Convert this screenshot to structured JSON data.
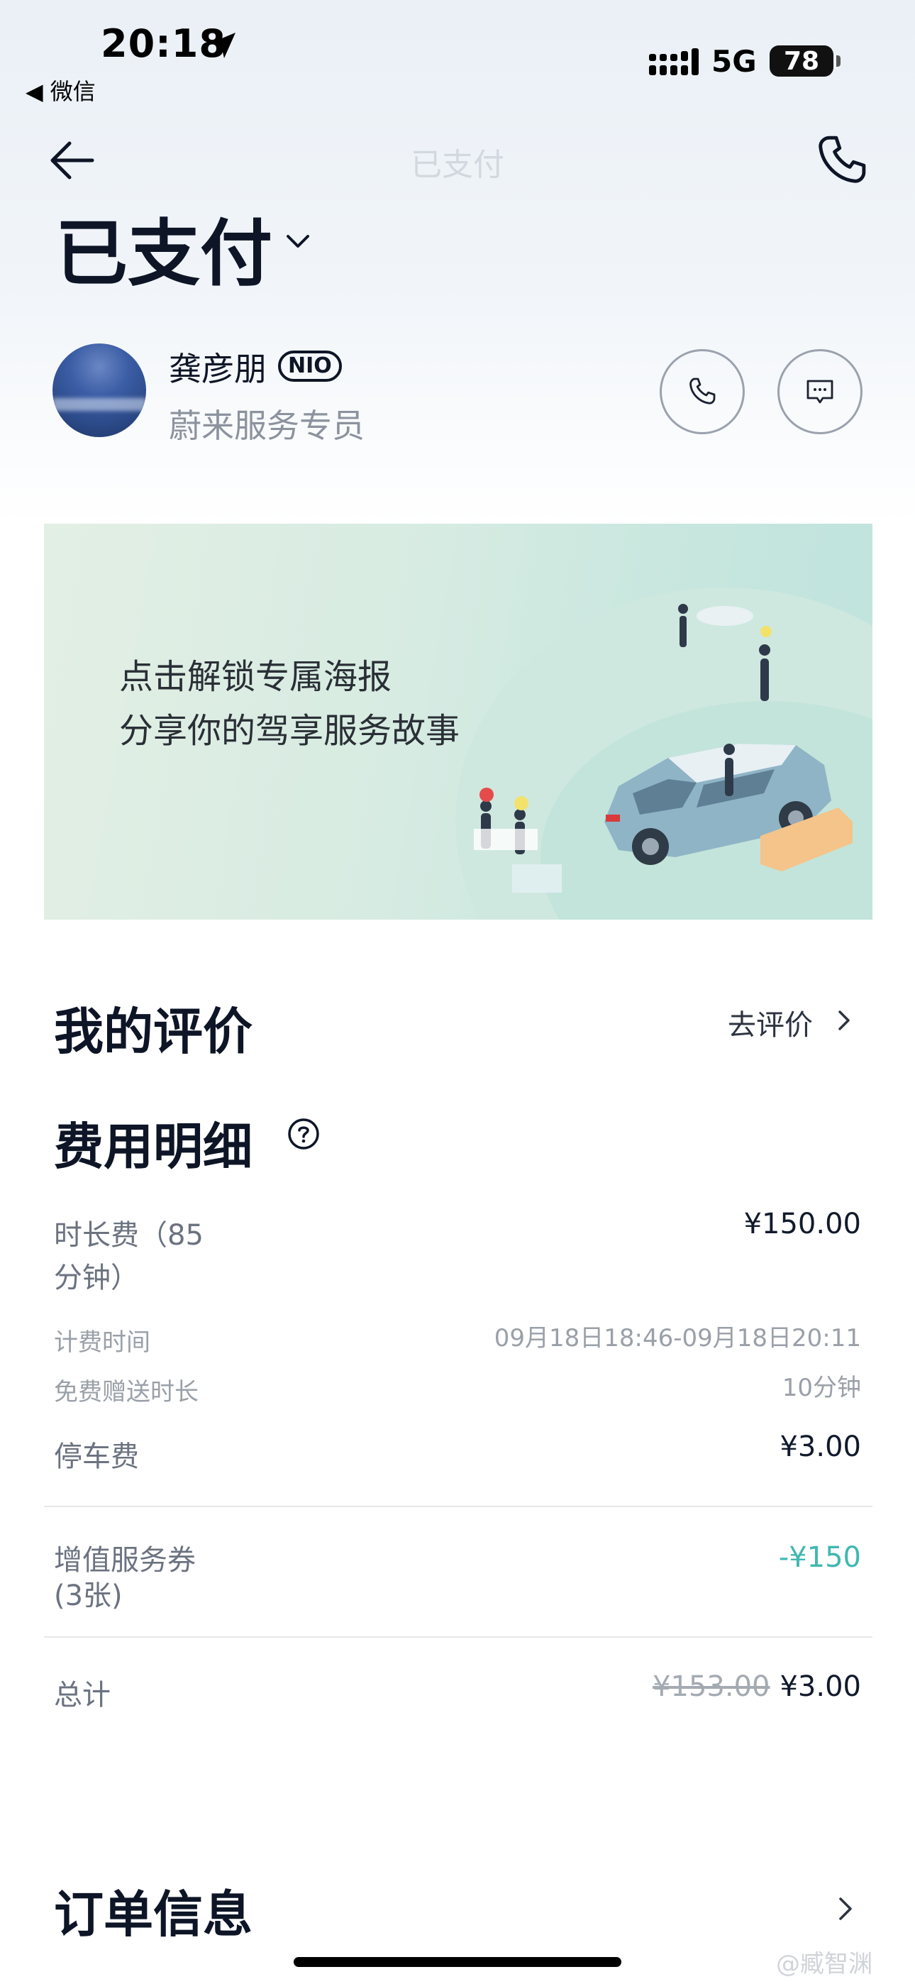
{
  "status_bar": {
    "time": "20:18",
    "back_app": "◀ 微信",
    "network": "5G",
    "battery": "78"
  },
  "nav": {
    "title": "已支付"
  },
  "order_status": {
    "title": "已支付"
  },
  "agent": {
    "name": "龚彦朋",
    "badge": "NIO",
    "role": "蔚来服务专员"
  },
  "banner": {
    "line1": "点击解锁专属海报",
    "line2": "分享你的驾享服务故事"
  },
  "review": {
    "title": "我的评价",
    "action": "去评价"
  },
  "fees": {
    "title": "费用明细",
    "duration_label_1": "时长费（85",
    "duration_label_2": "分钟）",
    "duration_value": "¥150.00",
    "billing_time_label": "计费时间",
    "billing_time_value": "09月18日18:46-09月18日20:11",
    "free_time_label": "免费赠送时长",
    "free_time_value": "10分钟",
    "parking_label": "停车费",
    "parking_value": "¥3.00",
    "coupon_label_1": "增值服务券",
    "coupon_label_2": "(3张)",
    "coupon_value": "-¥150",
    "total_label": "总计",
    "total_original": "¥153.00",
    "total_value": "¥3.00"
  },
  "order_info": {
    "title": "订单信息"
  },
  "watermark": "@臧智渊",
  "colors": {
    "accent_teal": "#3fb8b0",
    "primary_text": "#0d1526",
    "secondary_text": "#8c939e"
  },
  "icons": [
    "location-arrow-icon",
    "signal-icon",
    "back-arrow-icon",
    "phone-icon",
    "chevron-down-icon",
    "avatar",
    "call-icon",
    "message-icon",
    "chevron-right-icon",
    "help-icon"
  ]
}
